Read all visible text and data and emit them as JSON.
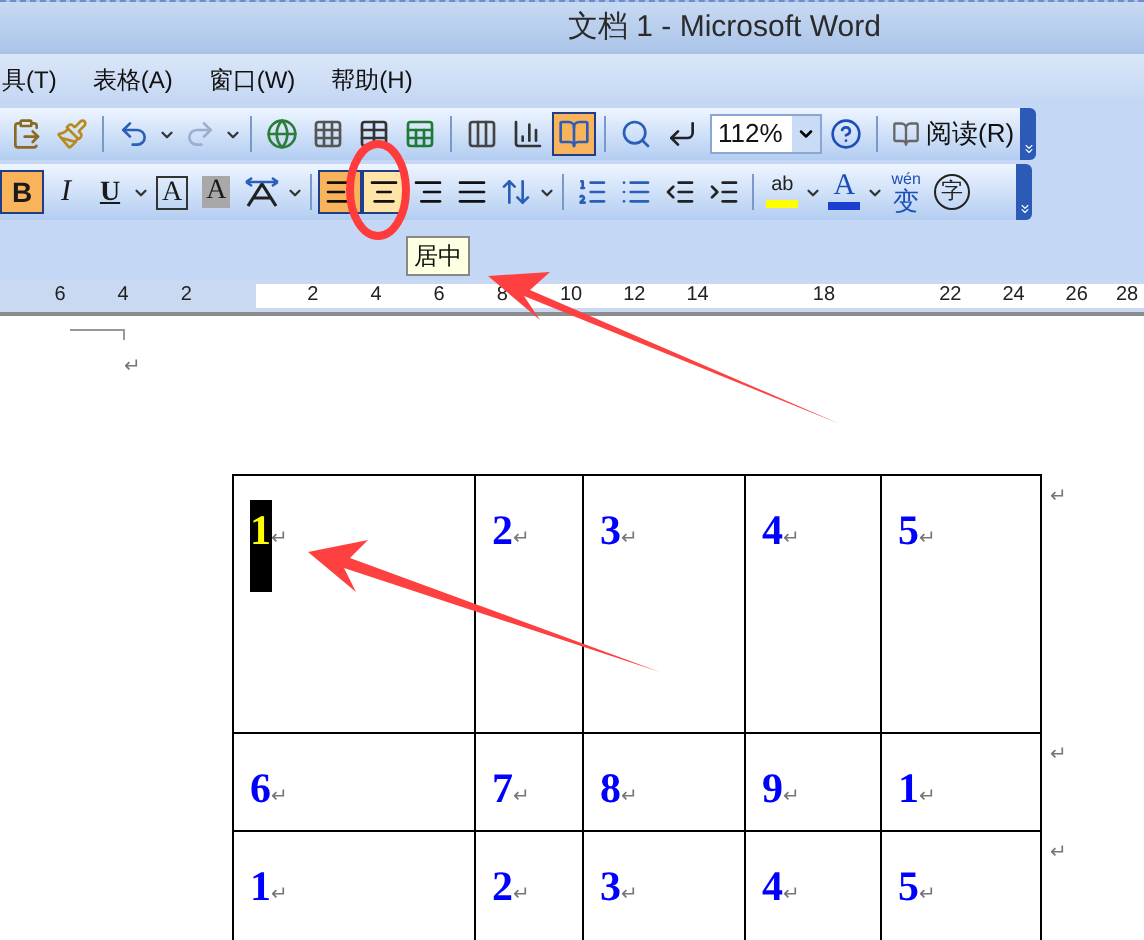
{
  "window": {
    "title": "文档 1 - Microsoft Word"
  },
  "menu": [
    {
      "label": "具(T)"
    },
    {
      "label": "表格(A)"
    },
    {
      "label": "窗口(W)"
    },
    {
      "label": "帮助(H)"
    }
  ],
  "standard_toolbar": {
    "document_map": {
      "on": true
    },
    "zoom": "112%",
    "read_button": "阅读(R)"
  },
  "formatting_toolbar": {
    "bold": {
      "label": "B",
      "on": true
    },
    "italic": {
      "label": "I",
      "on": false
    },
    "underline": {
      "label": "U",
      "on": false
    },
    "char_border": "A",
    "char_shading": "A",
    "alignment": [
      {
        "selected": true,
        "hovered": false
      },
      {
        "selected": false,
        "hovered": true
      },
      {
        "selected": false,
        "hovered": false
      },
      {
        "selected": false,
        "hovered": false
      }
    ],
    "highlight": "ab",
    "font_color": "A",
    "phonetic_top": "wén",
    "phonetic_char": "变",
    "enclose": "字"
  },
  "tooltip": "居中",
  "ruler": {
    "labels": [
      "6",
      "4",
      "2",
      "2",
      "4",
      "6",
      "8",
      "10",
      "12",
      "14",
      "18",
      "22",
      "24",
      "26",
      "28"
    ]
  },
  "document": {
    "paragraph_mark": "↵",
    "table": {
      "rows": [
        {
          "cells": [
            {
              "text": "1",
              "mark": "↵",
              "selected": true
            },
            {
              "text": "2",
              "mark": "↵",
              "selected": false
            },
            {
              "text": "3",
              "mark": "↵",
              "selected": false
            },
            {
              "text": "4",
              "mark": "↵",
              "selected": false
            },
            {
              "text": "5",
              "mark": "↵",
              "selected": false
            }
          ],
          "row_mark": "↵"
        },
        {
          "cells": [
            {
              "text": "6",
              "mark": "↵",
              "selected": false
            },
            {
              "text": "7",
              "mark": "↵",
              "selected": false
            },
            {
              "text": "8",
              "mark": "↵",
              "selected": false
            },
            {
              "text": "9",
              "mark": "↵",
              "selected": false
            },
            {
              "text": "1",
              "mark": "↵",
              "selected": false
            }
          ],
          "row_mark": "↵"
        },
        {
          "cells": [
            {
              "text": "1",
              "mark": "↵",
              "selected": false
            },
            {
              "text": "2",
              "mark": "↵",
              "selected": false
            },
            {
              "text": "3",
              "mark": "↵",
              "selected": false
            },
            {
              "text": "4",
              "mark": "↵",
              "selected": false
            },
            {
              "text": "5",
              "mark": "↵",
              "selected": false
            }
          ],
          "row_mark": "↵"
        }
      ]
    }
  }
}
